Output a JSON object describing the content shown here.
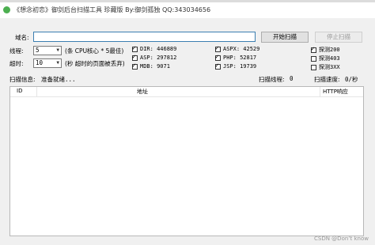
{
  "window": {
    "title": "《想念初恋》御剑后台扫描工具 珍藏版 By:御剑孤独 QQ:343034656"
  },
  "form": {
    "url_label": "域名:",
    "url_value": "",
    "start_button": "开始扫描",
    "stop_button": "停止扫描",
    "threads_label": "线程:",
    "threads_value": "5",
    "threads_hint": "(条 CPU核心 * 5最佳)",
    "timeout_label": "超时:",
    "timeout_value": "10",
    "timeout_hint": "(秒 超时的页面被丢弃)"
  },
  "dictionaries": [
    {
      "label": "DIR: 446889",
      "checked": true
    },
    {
      "label": "ASP: 297812",
      "checked": true
    },
    {
      "label": "MDB: 9071",
      "checked": true
    },
    {
      "label": "ASPX: 42529",
      "checked": true
    },
    {
      "label": "PHP: 52817",
      "checked": true
    },
    {
      "label": "JSP: 19739",
      "checked": true
    }
  ],
  "probes": [
    {
      "label": "探测200",
      "checked": true
    },
    {
      "label": "探测403",
      "checked": false
    },
    {
      "label": "探测3XX",
      "checked": false
    }
  ],
  "status": {
    "info_label": "扫描信息:",
    "info_value": "准备就绪...",
    "threads_label": "扫描线程:",
    "threads_value": "0",
    "speed_label": "扫描速度:",
    "speed_value": "0/秒"
  },
  "table": {
    "columns": [
      "ID",
      "地址",
      "HTTP响应"
    ]
  },
  "watermark": "CSDN @Don’t know"
}
